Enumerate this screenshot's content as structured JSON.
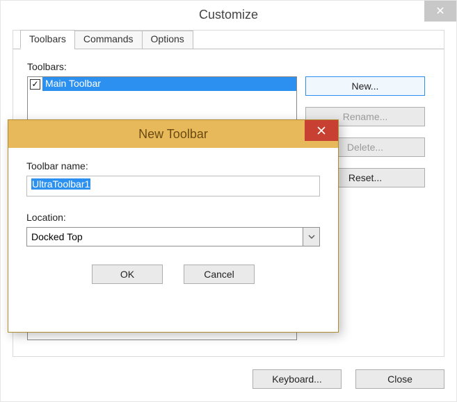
{
  "window": {
    "title": "Customize",
    "close_glyph": "✕"
  },
  "tabs": {
    "toolbars": "Toolbars",
    "commands": "Commands",
    "options": "Options"
  },
  "toolbars_section": {
    "label": "Toolbars:",
    "items": [
      {
        "label": "Main Toolbar",
        "checked": true
      }
    ]
  },
  "side_buttons": {
    "new": "New...",
    "rename": "Rename...",
    "delete": "Delete...",
    "reset": "Reset..."
  },
  "bottom_buttons": {
    "keyboard": "Keyboard...",
    "close": "Close"
  },
  "modal": {
    "title": "New Toolbar",
    "name_label": "Toolbar name:",
    "name_value": "UltraToolbar1",
    "location_label": "Location:",
    "location_value": "Docked Top",
    "ok": "OK",
    "cancel": "Cancel"
  }
}
